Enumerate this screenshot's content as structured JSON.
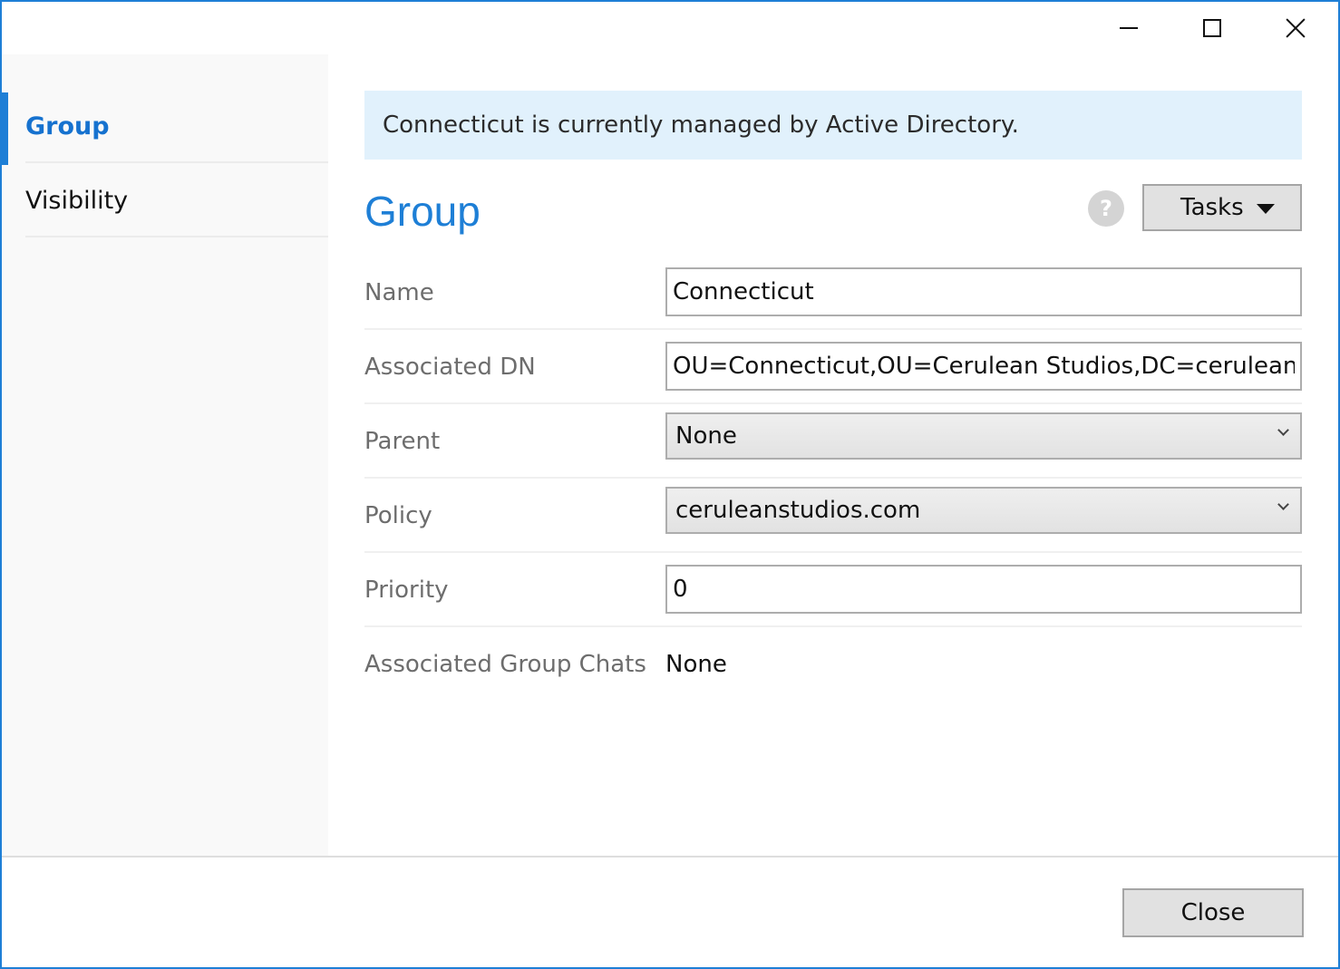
{
  "window": {
    "controls": [
      "minimize",
      "maximize",
      "close"
    ]
  },
  "sidebar": {
    "items": [
      {
        "label": "Group",
        "active": true
      },
      {
        "label": "Visibility",
        "active": false
      }
    ]
  },
  "banner": {
    "text": "Connecticut is currently managed by Active Directory."
  },
  "section": {
    "title": "Group",
    "help_glyph": "?",
    "tasks_label": "Tasks"
  },
  "form": {
    "name": {
      "label": "Name",
      "value": "Connecticut"
    },
    "dn": {
      "label": "Associated DN",
      "value": "OU=Connecticut,OU=Cerulean Studios,DC=ceruleanstudios,DC=com"
    },
    "parent": {
      "label": "Parent",
      "value": "None"
    },
    "policy": {
      "label": "Policy",
      "value": "ceruleanstudios.com"
    },
    "priority": {
      "label": "Priority",
      "value": "0"
    },
    "group_chats": {
      "label": "Associated Group Chats",
      "value": "None"
    }
  },
  "footer": {
    "close_label": "Close"
  },
  "colors": {
    "accent": "#1e7fd6",
    "banner_bg": "#e1f1fc",
    "sidebar_bg": "#f9f9f9"
  },
  "icons": {
    "help": "question-circle-icon",
    "tasks_dropdown": "caret-down-icon",
    "select_dropdown": "chevron-down-icon"
  }
}
